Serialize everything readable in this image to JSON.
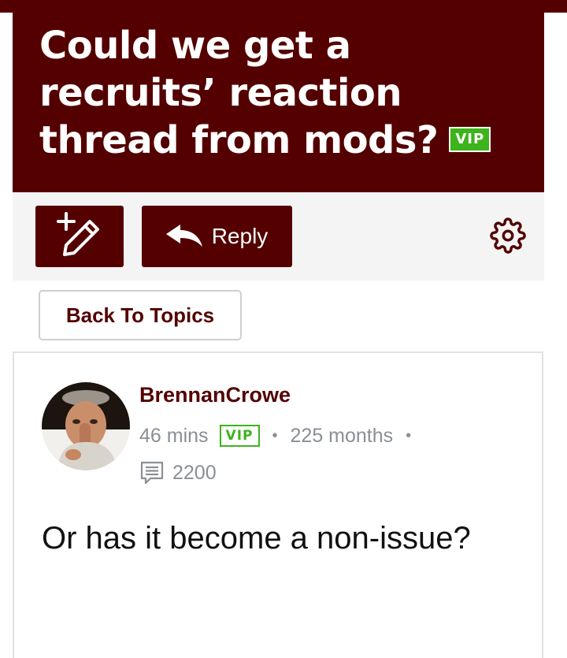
{
  "topic": {
    "title": "Could we get a recruits’ reaction thread from mods?",
    "title_badge": "VIP"
  },
  "toolbar": {
    "compose_icon": "pencil-plus-icon",
    "reply_icon": "reply-arrow-icon",
    "reply_label": "Reply",
    "settings_icon": "gear-icon"
  },
  "nav": {
    "back_label": "Back To Topics"
  },
  "post": {
    "author": "BrennanCrowe",
    "time_ago": "46 mins",
    "badge": "VIP",
    "member_for": "225 months",
    "separator": "•",
    "post_count": "2200",
    "post_count_icon": "comment-icon",
    "body": "Or has it become a non-issue?"
  },
  "colors": {
    "brand": "#540000",
    "vip_green": "#3db31c",
    "meta_gray": "#8a8f96",
    "toolbar_bg": "#f4f4f4"
  }
}
